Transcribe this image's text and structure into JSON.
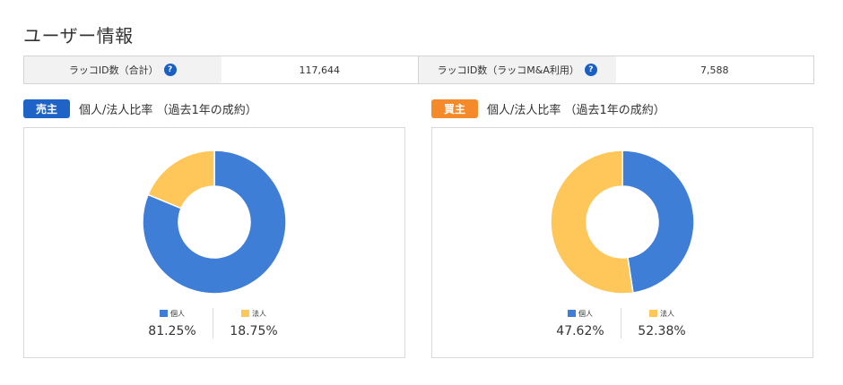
{
  "page_title": "ユーザー情報",
  "stats": [
    {
      "label": "ラッコID数（合計）",
      "value": "117,644"
    },
    {
      "label": "ラッコID数（ラッコM&A利用）",
      "value": "7,588"
    }
  ],
  "icons": {
    "help": "help-icon"
  },
  "colors": {
    "individual": "#3f7ed6",
    "corporate": "#ffc65a",
    "seller_badge": "#1f63c7",
    "buyer_badge": "#f58a2a"
  },
  "sections": [
    {
      "badge": "売主",
      "title": "個人/法人比率 （過去1年の成約）"
    },
    {
      "badge": "買主",
      "title": "個人/法人比率 （過去1年の成約）"
    }
  ],
  "chart_data": [
    {
      "type": "pie",
      "categories": [
        "個人",
        "法人"
      ],
      "values": [
        81.25,
        18.75
      ],
      "labels": [
        "81.25%",
        "18.75%"
      ],
      "colors": [
        "#3f7ed6",
        "#ffc65a"
      ],
      "donut": true,
      "legend": "bottom"
    },
    {
      "type": "pie",
      "categories": [
        "個人",
        "法人"
      ],
      "values": [
        47.62,
        52.38
      ],
      "labels": [
        "47.62%",
        "52.38%"
      ],
      "colors": [
        "#3f7ed6",
        "#ffc65a"
      ],
      "donut": true,
      "legend": "bottom"
    }
  ]
}
